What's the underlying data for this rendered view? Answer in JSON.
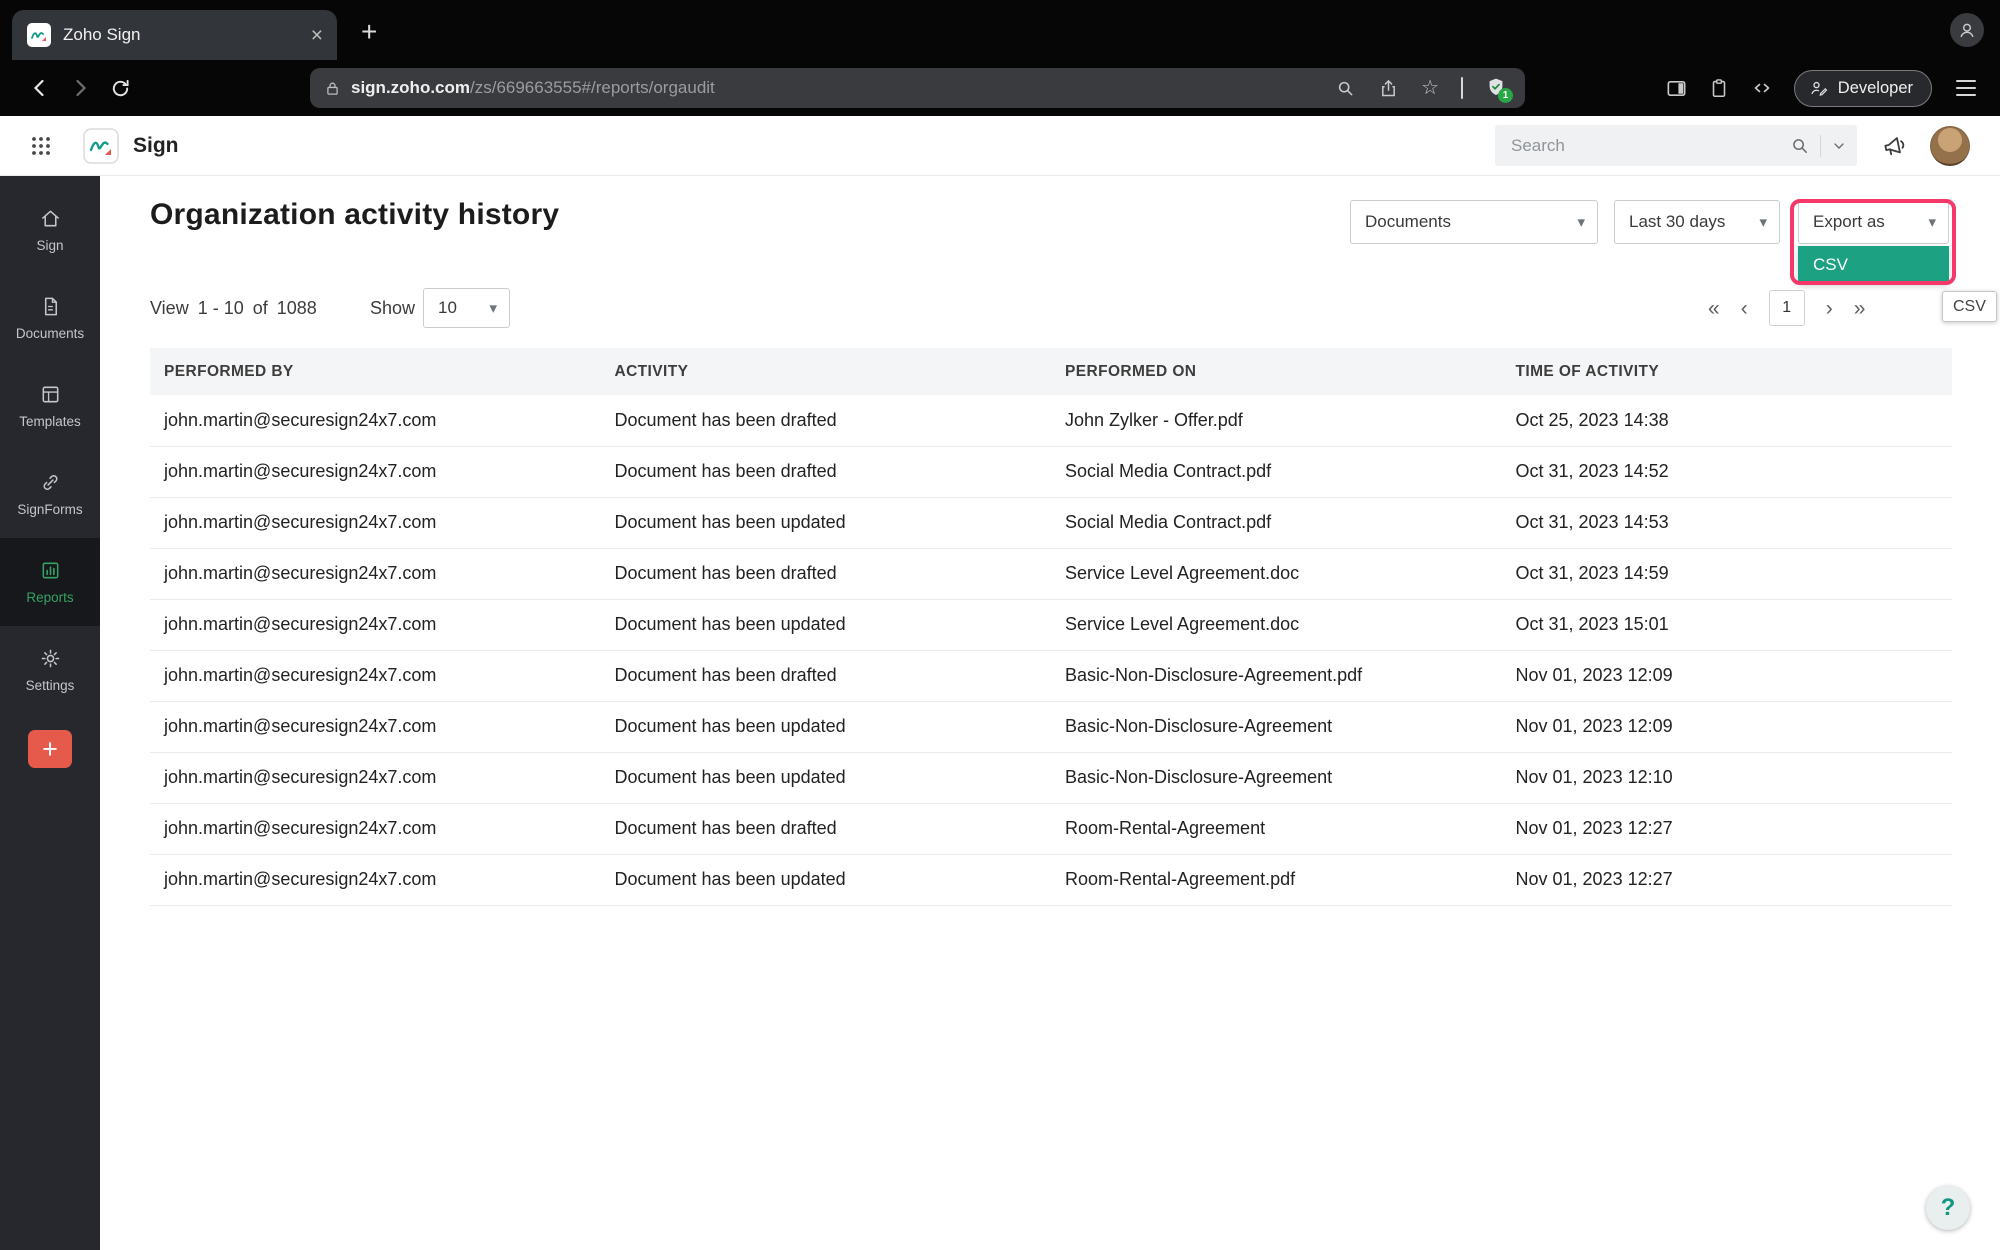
{
  "glyphs": {
    "close": "×",
    "plus": "+",
    "star": "☆",
    "select_chevron": "▾",
    "help": "?"
  },
  "browser": {
    "tab_title": "Zoho Sign",
    "url_domain": "sign.zoho.com",
    "url_path": "/zs/669663555#/reports/orgaudit",
    "shield_badge": "1",
    "developer_label": "Developer"
  },
  "app_header": {
    "brand": "Sign",
    "search_placeholder": "Search"
  },
  "sidebar": {
    "items": [
      {
        "label": "Sign"
      },
      {
        "label": "Documents"
      },
      {
        "label": "Templates"
      },
      {
        "label": "SignForms"
      },
      {
        "label": "Reports"
      },
      {
        "label": "Settings"
      }
    ]
  },
  "main": {
    "title": "Organization activity history",
    "filters": {
      "category": "Documents",
      "date_range": "Last 30 days",
      "export_label": "Export as",
      "export_option_csv": "CSV",
      "export_tooltip": "CSV"
    },
    "pagination": {
      "view_label": "View",
      "range": "1 - 10",
      "of_label": "of",
      "total": "1088",
      "show_label": "Show",
      "page_size": "10",
      "first": "«",
      "prev": "‹",
      "page": "1",
      "next": "›",
      "last": "»"
    },
    "table": {
      "columns": [
        "PERFORMED BY",
        "ACTIVITY",
        "PERFORMED ON",
        "TIME OF ACTIVITY"
      ],
      "rows": [
        [
          "john.martin@securesign24x7.com",
          "Document has been drafted",
          "John Zylker - Offer.pdf",
          "Oct 25, 2023 14:38"
        ],
        [
          "john.martin@securesign24x7.com",
          "Document has been drafted",
          "Social Media Contract.pdf",
          "Oct 31, 2023 14:52"
        ],
        [
          "john.martin@securesign24x7.com",
          "Document has been updated",
          "Social Media Contract.pdf",
          "Oct 31, 2023 14:53"
        ],
        [
          "john.martin@securesign24x7.com",
          "Document has been drafted",
          "Service Level Agreement.doc",
          "Oct 31, 2023 14:59"
        ],
        [
          "john.martin@securesign24x7.com",
          "Document has been updated",
          "Service Level Agreement.doc",
          "Oct 31, 2023 15:01"
        ],
        [
          "john.martin@securesign24x7.com",
          "Document has been drafted",
          "Basic-Non-Disclosure-Agreement.pdf",
          "Nov 01, 2023 12:09"
        ],
        [
          "john.martin@securesign24x7.com",
          "Document has been updated",
          "Basic-Non-Disclosure-Agreement",
          "Nov 01, 2023 12:09"
        ],
        [
          "john.martin@securesign24x7.com",
          "Document has been updated",
          "Basic-Non-Disclosure-Agreement",
          "Nov 01, 2023 12:10"
        ],
        [
          "john.martin@securesign24x7.com",
          "Document has been drafted",
          "Room-Rental-Agreement",
          "Nov 01, 2023 12:27"
        ],
        [
          "john.martin@securesign24x7.com",
          "Document has been updated",
          "Room-Rental-Agreement.pdf",
          "Nov 01, 2023 12:27"
        ]
      ]
    }
  },
  "colors": {
    "accent_teal": "#1ca182",
    "annotation_pink": "#f4386a",
    "sidebar_active_green": "#35a263",
    "plus_red": "#e65a4b"
  }
}
